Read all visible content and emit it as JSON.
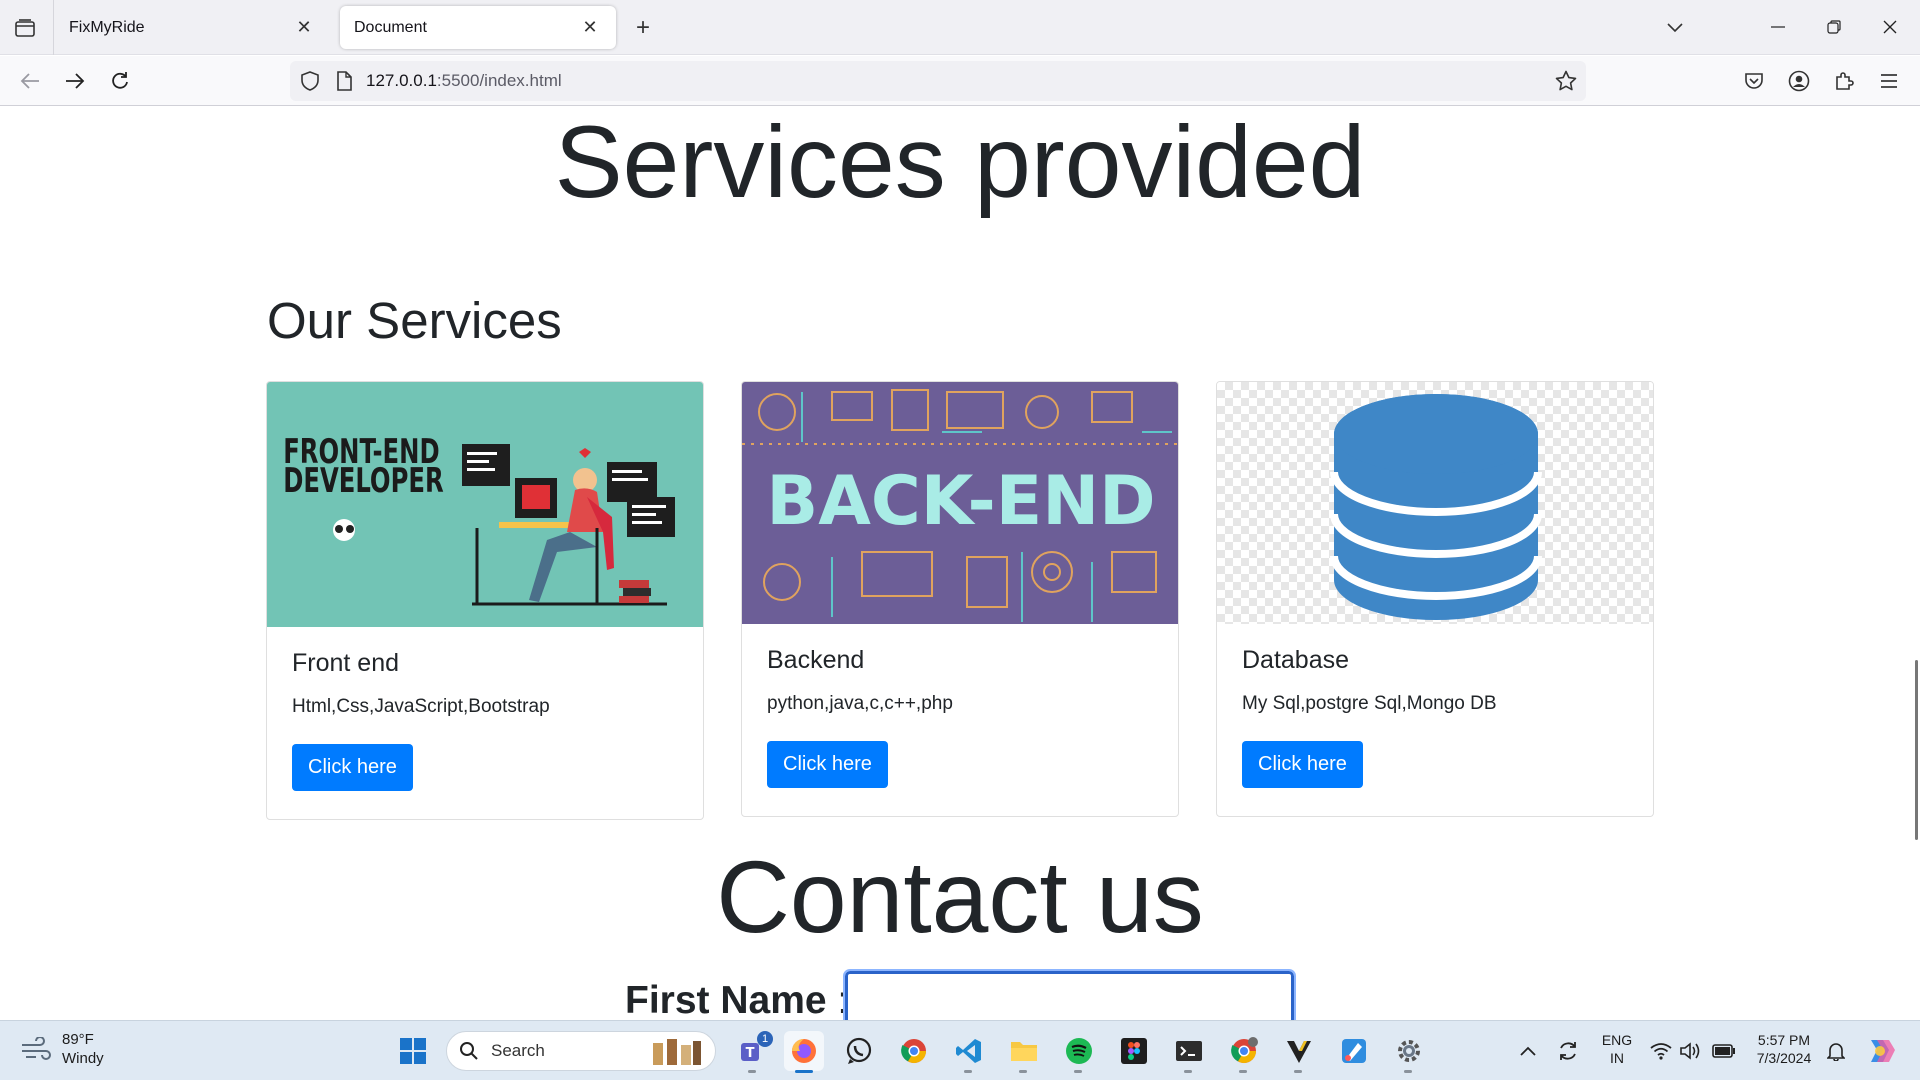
{
  "browser": {
    "tabs": [
      {
        "title": "FixMyRide",
        "active": false
      },
      {
        "title": "Document",
        "active": true
      }
    ],
    "url": {
      "host": "127.0.0.1",
      "path": ":5500/index.html"
    }
  },
  "page": {
    "services_heading": "Services provided",
    "our_services_heading": "Our Services",
    "cards": [
      {
        "title": "Front end",
        "text": "Html,Css,JavaScript,Bootstrap",
        "button": "Click here",
        "image_text_1": "FRONT-END",
        "image_text_2": "DEVELOPER"
      },
      {
        "title": "Backend",
        "text": "python,java,c,c++,php",
        "button": "Click here",
        "image_text": "BACK-END"
      },
      {
        "title": "Database",
        "text": "My Sql,postgre Sql,Mongo DB",
        "button": "Click here"
      }
    ],
    "contact_heading": "Contact us",
    "first_name_label": "First Name",
    "first_name_colon": ":"
  },
  "taskbar": {
    "weather_temp": "89°F",
    "weather_desc": "Windy",
    "search_placeholder": "Search",
    "teams_badge": "1",
    "lang_1": "ENG",
    "lang_2": "IN",
    "time": "5:57 PM",
    "date": "7/3/2024"
  },
  "colors": {
    "button_primary": "#007bff",
    "frontend_bg": "#72c4b5",
    "backend_bg": "#6c5e97",
    "database_blue": "#3f87c7"
  }
}
